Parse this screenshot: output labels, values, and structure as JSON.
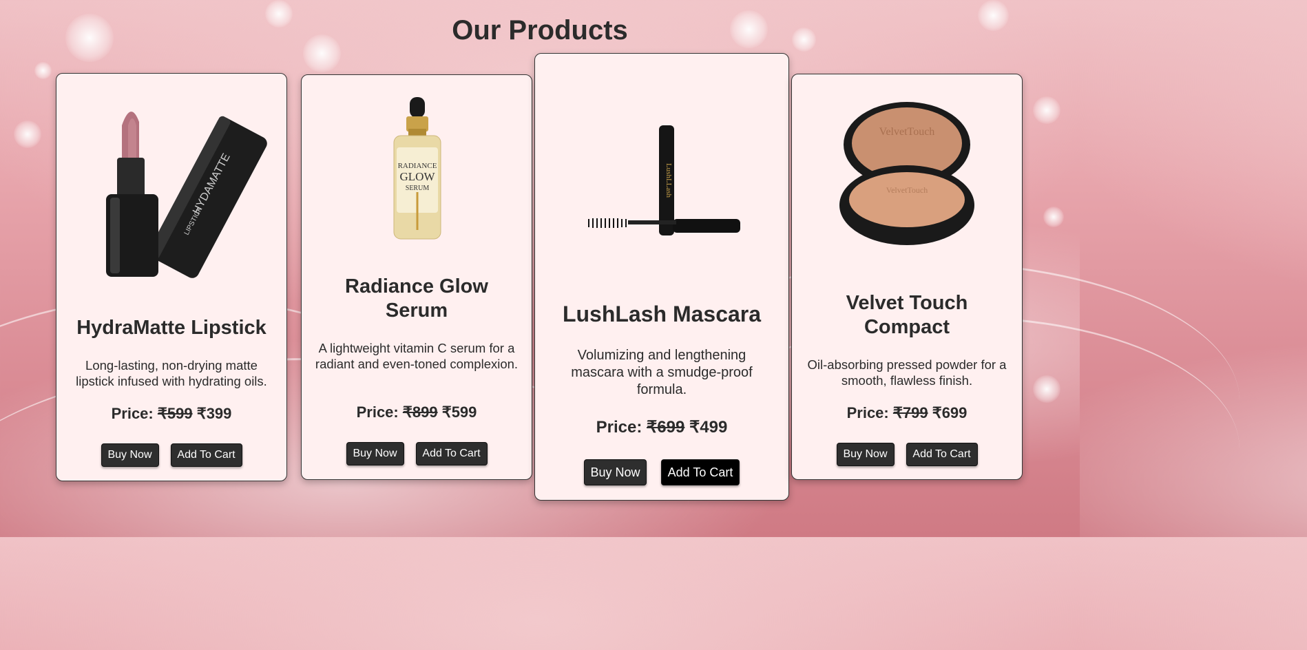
{
  "page": {
    "title": "Our Products"
  },
  "products": [
    {
      "name": "HydraMatte Lipstick",
      "description": "Long-lasting, non-drying matte lipstick infused with hydrating oils.",
      "price_label": "Price:",
      "old_price": "₹599",
      "new_price": "₹399",
      "image_text_1": "HYDAMATTE",
      "image_text_2": "LIPSTICK",
      "buy_label": "Buy Now",
      "cart_label": "Add To Cart"
    },
    {
      "name": "Radiance Glow Serum",
      "description": "A lightweight vitamin C serum for a radiant and even-toned complexion.",
      "price_label": "Price:",
      "old_price": "₹899",
      "new_price": "₹599",
      "image_text_1": "RADIANCE",
      "image_text_2": "GLOW",
      "image_text_3": "SERUM",
      "buy_label": "Buy Now",
      "cart_label": "Add To Cart"
    },
    {
      "name": "LushLash Mascara",
      "description": "Volumizing and lengthening mascara with a smudge-proof formula.",
      "price_label": "Price:",
      "old_price": "₹699",
      "new_price": "₹499",
      "image_text_1": "LushLLash",
      "buy_label": "Buy Now",
      "cart_label": "Add To Cart"
    },
    {
      "name": "Velvet Touch Compact",
      "description": "Oil-absorbing pressed powder for a smooth, flawless finish.",
      "price_label": "Price:",
      "old_price": "₹799",
      "new_price": "₹699",
      "image_text_1": "VelvetTouch",
      "buy_label": "Buy Now",
      "cart_label": "Add To Cart"
    }
  ],
  "colors": {
    "card_bg": "#fff0f0",
    "button_bg": "#2e2e2e",
    "button_active_bg": "#000000",
    "text": "#2b2b2b"
  }
}
